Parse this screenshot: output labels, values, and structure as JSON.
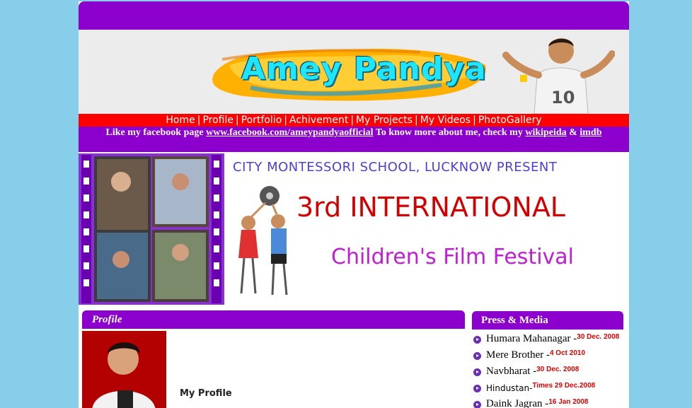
{
  "banner": {
    "logo_text": "Amey Pandya"
  },
  "nav": {
    "items": [
      "Home",
      "Profile",
      "Portfolio",
      "Achivement",
      "My Projects",
      "My Videos",
      "PhotoGallery"
    ],
    "separator": "|"
  },
  "facebook_line": {
    "prefix": "Like my facebook page ",
    "fb_link": "www.facebook.com/ameypandyaofficial",
    "middle": " To know more about me, check my ",
    "wiki_link": "wikipeida",
    "amp": " & ",
    "imdb_link": "imdb"
  },
  "festival": {
    "line1": "CITY MONTESSORI SCHOOL, LUCKNOW PRESENT",
    "line2": "3rd INTERNATIONAL",
    "line3": "Children's Film Festival"
  },
  "profile": {
    "heading": "Profile",
    "subheading": "My Profile"
  },
  "press": {
    "heading": "Press & Media",
    "items": [
      {
        "name": "Humara Mahanagar -",
        "date": "30 Dec. 2008"
      },
      {
        "name": "Mere Brother -",
        "date": "4 Oct 2010"
      },
      {
        "name": "Navbharat -",
        "date": "30 Dec. 2008"
      },
      {
        "name": "Hindustan-",
        "date": "Times 29 Dec.2008"
      },
      {
        "name": "Daink Jagran -",
        "date": "16 Jan 2008"
      }
    ]
  },
  "colors": {
    "background": "#87ceeb",
    "accent_purple": "#8b00cc",
    "nav_red": "#ff0000"
  }
}
